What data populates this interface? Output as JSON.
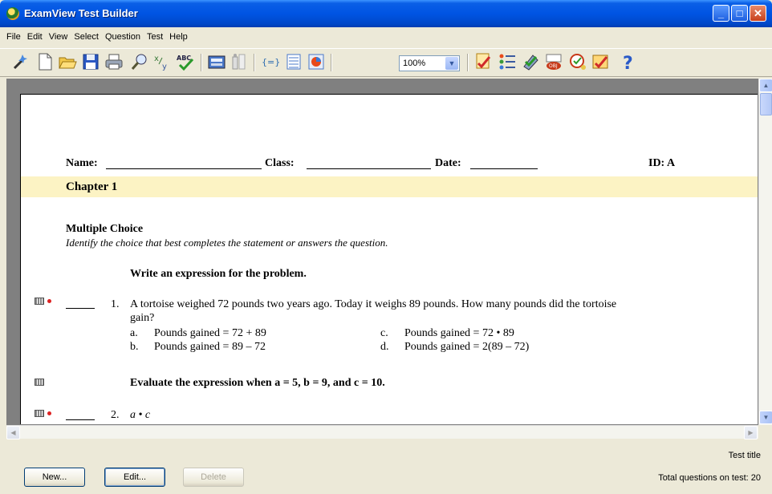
{
  "window": {
    "title": "ExamView Test Builder"
  },
  "menu": [
    "File",
    "Edit",
    "View",
    "Select",
    "Question",
    "Test",
    "Help"
  ],
  "toolbar": {
    "zoom": "100%"
  },
  "document": {
    "header": {
      "name_label": "Name:",
      "class_label": "Class:",
      "date_label": "Date:",
      "id_label": "ID: A"
    },
    "chapter": "Chapter 1",
    "section": {
      "title": "Multiple Choice",
      "subtitle": "Identify the choice that best completes the statement or answers the question."
    },
    "instruction1": "Write an expression for the problem.",
    "q1": {
      "number": "1.",
      "text_line1": "A tortoise weighed 72 pounds two years ago. Today it weighs 89 pounds. How many pounds did the tortoise",
      "text_line2": "gain?",
      "choices": [
        {
          "letter": "a.",
          "text": "Pounds gained = 72 + 89"
        },
        {
          "letter": "b.",
          "text": "Pounds gained = 89 – 72"
        },
        {
          "letter": "c.",
          "text": "Pounds gained = 72 • 89"
        },
        {
          "letter": "d.",
          "text": "Pounds gained = 2(89 – 72)"
        }
      ]
    },
    "instruction2": "Evaluate the expression when a = 5, b = 9, and c = 10.",
    "q2": {
      "number": "2.",
      "text": "a • c"
    }
  },
  "status": {
    "test_title": "Test title",
    "total_questions": "Total questions on test: 20"
  },
  "buttons": {
    "new": "New...",
    "edit": "Edit...",
    "delete": "Delete"
  },
  "colors": {
    "titlebar": "#0054e3",
    "chapter_band": "#fcf3c4",
    "flag_dot": "#dd2222"
  }
}
